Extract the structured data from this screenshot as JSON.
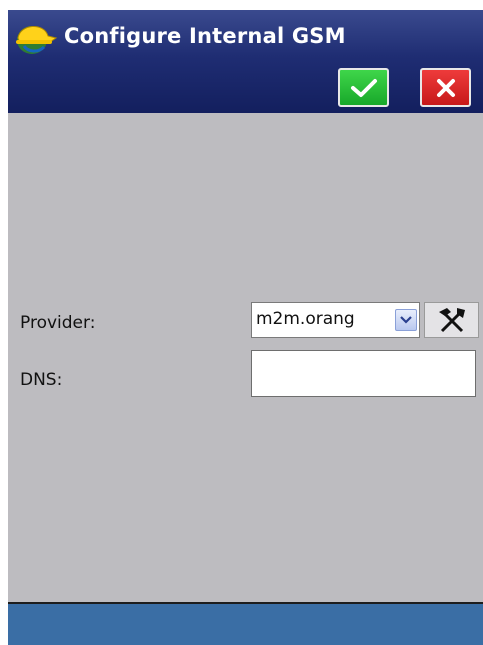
{
  "window": {
    "title": "Configure Internal GSM",
    "ok_icon": "checkmark-icon",
    "cancel_icon": "close-icon"
  },
  "form": {
    "provider_label": "Provider:",
    "provider_value": "m2m.orang",
    "dns_label": "DNS:",
    "dns_value": "",
    "tools_icon": "tools-icon"
  },
  "colors": {
    "title_bar": "#1f2d73",
    "ok_button": "#22b030",
    "cancel_button": "#d42020",
    "body_background": "#bdbcc0",
    "bottom_bar": "#3a6ea5"
  }
}
